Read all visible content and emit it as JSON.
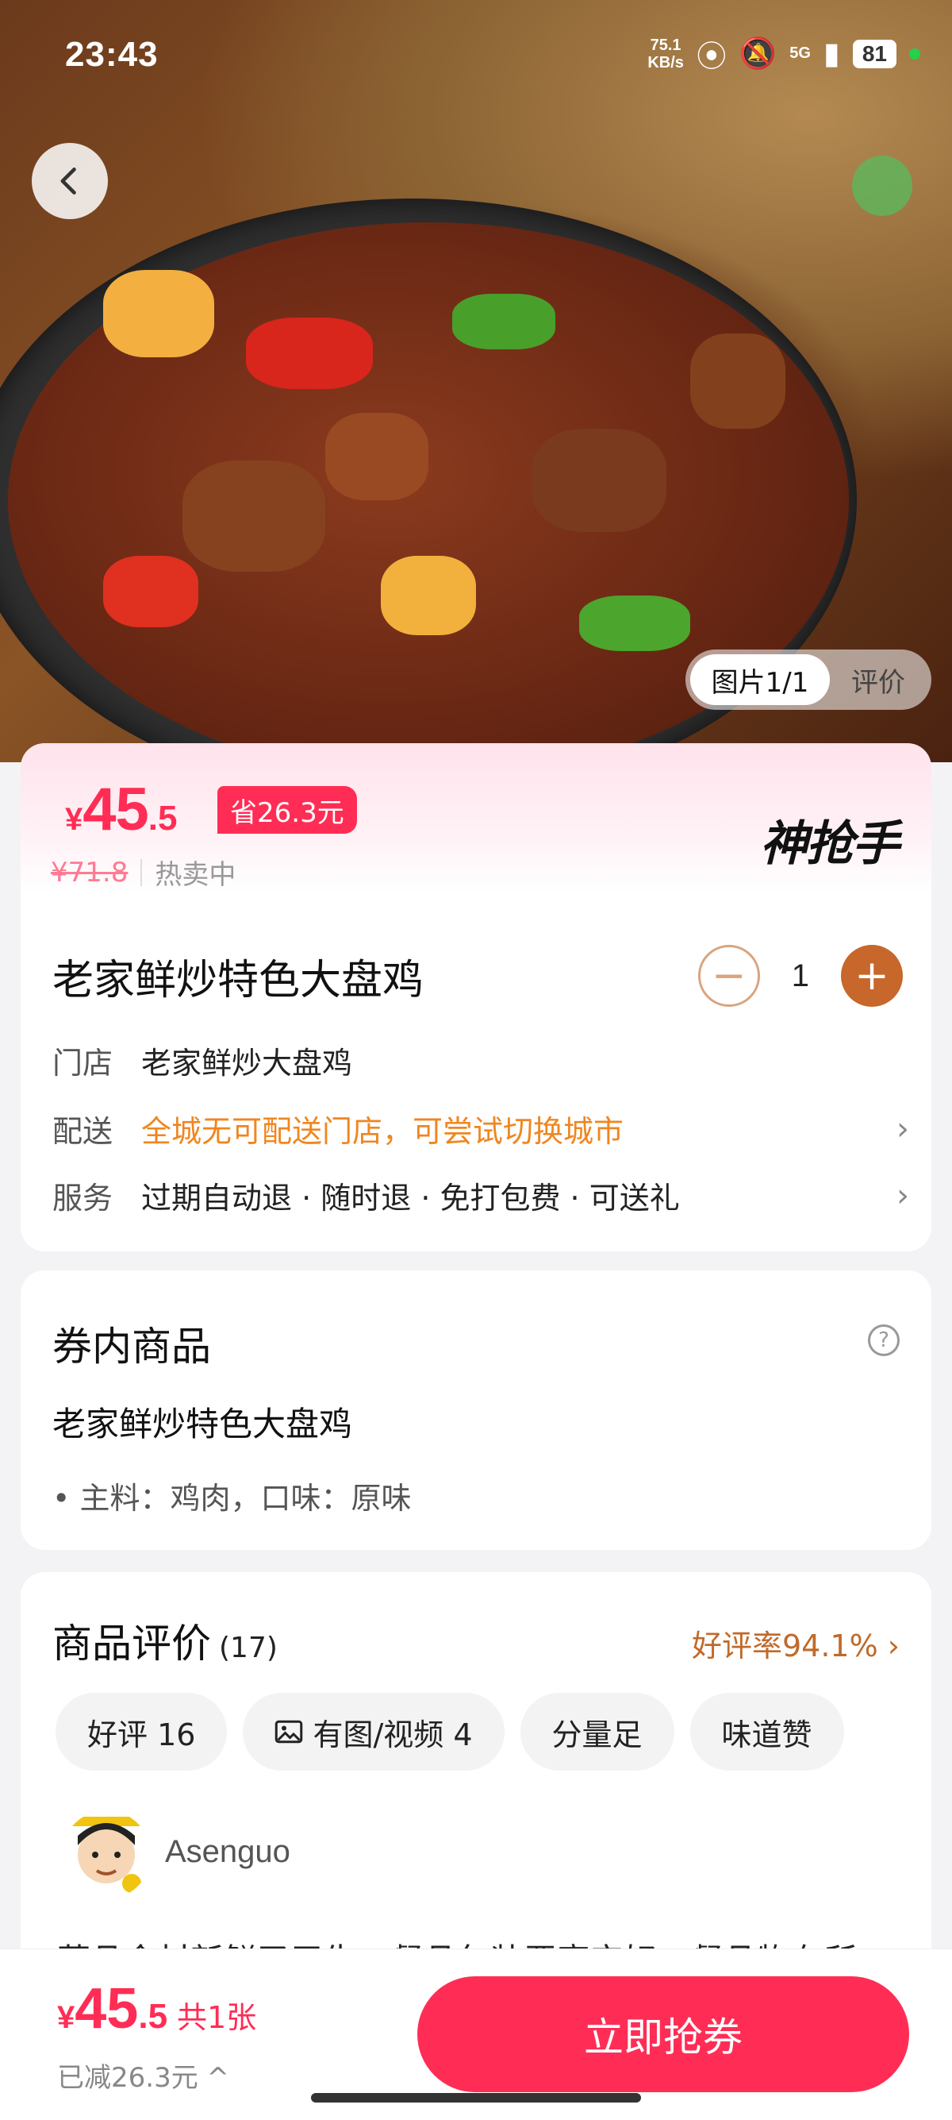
{
  "status_bar": {
    "time": "23:43",
    "net_speed_value": "75.1",
    "net_speed_unit": "KB/s",
    "signal": "5G",
    "battery": "81"
  },
  "hero": {
    "image_tab_label": "图片1/1",
    "review_tab_label": "评价"
  },
  "price": {
    "currency": "¥",
    "integer": "45",
    "decimal": ".5",
    "save_badge": "省26.3元",
    "original_price": "¥71.8",
    "status": "热卖中",
    "brand": "神抢手"
  },
  "product": {
    "title": "老家鲜炒特色大盘鸡",
    "quantity": "1",
    "store_label": "门店",
    "store_value": "老家鲜炒大盘鸡",
    "delivery_label": "配送",
    "delivery_value": "全城无可配送门店，可尝试切换城市",
    "service_label": "服务",
    "service_value": "过期自动退 · 随时退 · 免打包费 · 可送礼"
  },
  "coupon": {
    "section_title": "券内商品",
    "item_name": "老家鲜炒特色大盘鸡",
    "item_detail": "• 主料：鸡肉，口味：原味"
  },
  "reviews": {
    "section_title": "商品评价",
    "count": "(17)",
    "positive_rate": "好评率94.1% ›",
    "chips": [
      "好评 16",
      "有图/视频 4",
      "分量足",
      "味道赞"
    ],
    "reviewer": "Asenguo",
    "review_text": "菜品食材新鲜又卫生，餐品包装严密完好，餐品物有所"
  },
  "bottom_bar": {
    "currency": "¥",
    "integer": "45",
    "decimal": ".5",
    "count": "共1张",
    "saved": "已减26.3元 ^",
    "buy_label": "立即抢券"
  },
  "colors": {
    "accent": "#ff2d55",
    "orange": "#f0861f",
    "brown": "#c7672b"
  }
}
